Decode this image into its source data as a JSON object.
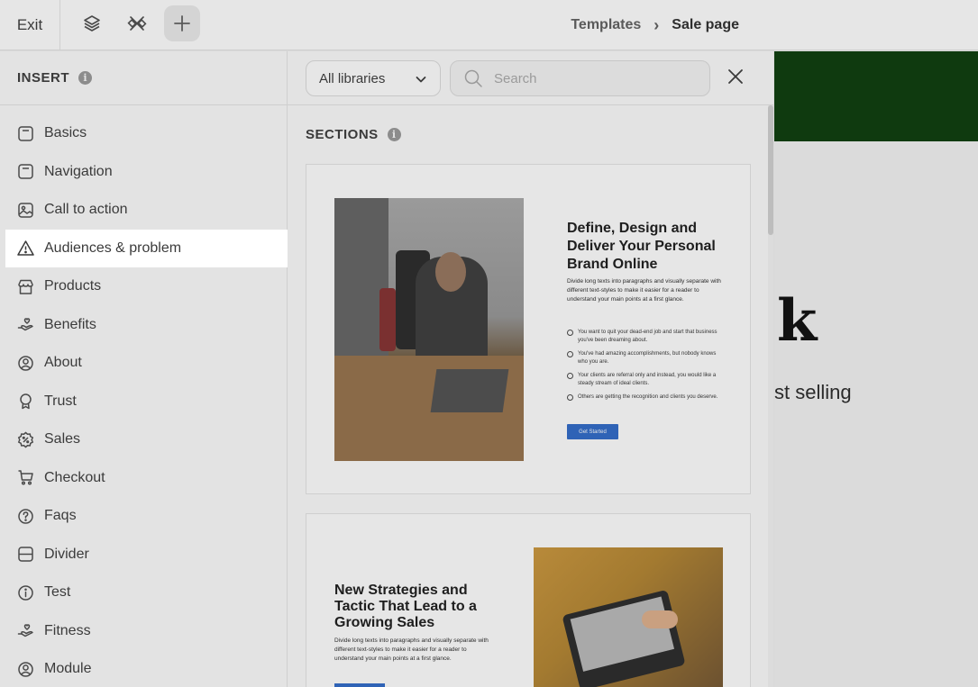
{
  "topbar": {
    "exit_label": "Exit",
    "breadcrumb": {
      "parent": "Templates",
      "separator": "›",
      "current": "Sale page"
    },
    "icons": [
      "layers-icon",
      "tools-icon",
      "plus-icon"
    ]
  },
  "sidebar": {
    "title": "INSERT",
    "info_glyph": "i",
    "selected": "Audiences & problem",
    "items": [
      {
        "label": "Basics",
        "icon": "basics-icon"
      },
      {
        "label": "Navigation",
        "icon": "navigation-icon"
      },
      {
        "label": "Call to action",
        "icon": "image-icon"
      },
      {
        "label": "Audiences & problem",
        "icon": "warning-icon"
      },
      {
        "label": "Products",
        "icon": "store-icon"
      },
      {
        "label": "Benefits",
        "icon": "hand-heart-icon"
      },
      {
        "label": "About",
        "icon": "user-circle-icon"
      },
      {
        "label": "Trust",
        "icon": "award-icon"
      },
      {
        "label": "Sales",
        "icon": "discount-icon"
      },
      {
        "label": "Checkout",
        "icon": "cart-icon"
      },
      {
        "label": "Faqs",
        "icon": "question-icon"
      },
      {
        "label": "Divider",
        "icon": "divider-icon"
      },
      {
        "label": "Test",
        "icon": "info-icon"
      },
      {
        "label": "Fitness",
        "icon": "hand-heart-icon"
      },
      {
        "label": "Module",
        "icon": "user-circle-icon"
      }
    ]
  },
  "panel": {
    "library_select": "All libraries",
    "search_placeholder": "Search",
    "section_title": "SECTIONS",
    "info_glyph": "i",
    "cards": [
      {
        "title": "Define, Design and Deliver Your Personal Brand Online",
        "description": "Divide long texts into paragraphs and visually separate with different text-styles to make it easier for a reader to understand your main points at a first glance.",
        "bullets": [
          "You want to quit your dead-end job and start that business you've been dreaming about.",
          "You've had amazing accomplishments, but nobody knows who you are.",
          "Your clients are referral only and instead, you would like a steady stream of ideal clients.",
          "Others are getting the recognition and clients you deserve."
        ],
        "button": "Get Started"
      },
      {
        "title": "New Strategies and Tactic That Lead to a Growing Sales",
        "description": "Divide long texts into paragraphs and visually separate with different text-styles to make it easier for a reader to understand your main points at a first glance."
      }
    ]
  },
  "canvas": {
    "heading_fragment": "k",
    "subtitle_fragment": "st selling",
    "band_color": "#0f3a0f"
  }
}
